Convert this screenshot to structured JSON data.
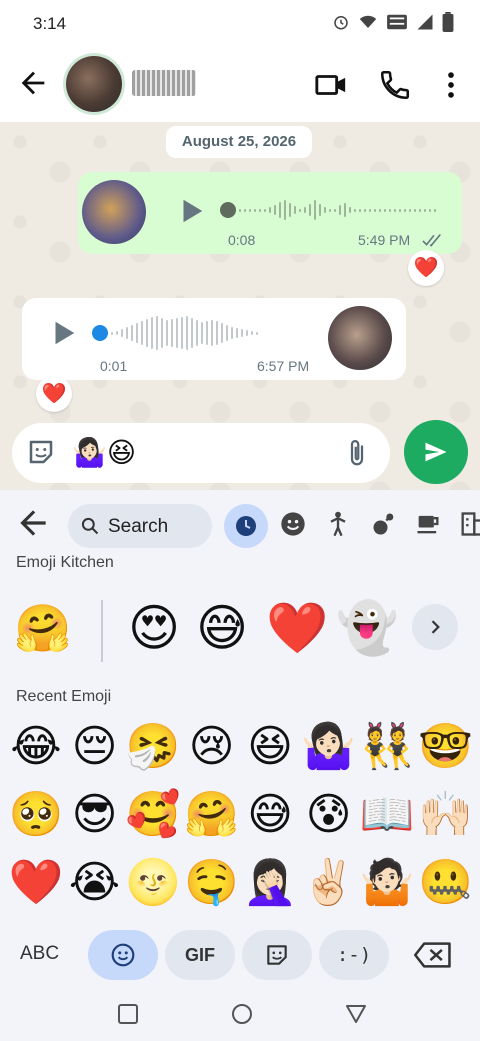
{
  "status": {
    "time": "3:14",
    "icons": [
      "alarm-icon",
      "wifi-icon",
      "vowifi-icon",
      "signal-icon",
      "battery-icon"
    ]
  },
  "header": {
    "back": "back-arrow-icon",
    "video_call": "video-call-icon",
    "voice_call": "phone-icon",
    "menu": "more-vert-icon"
  },
  "chat": {
    "date": "August 25, 2026",
    "messages": [
      {
        "direction": "outgoing",
        "type": "voice",
        "duration": "0:08",
        "time": "5:49 PM",
        "status": "read-ticks",
        "reaction": "❤️"
      },
      {
        "direction": "incoming",
        "type": "voice",
        "duration": "0:01",
        "time": "6:57 PM",
        "reaction": "❤️"
      }
    ]
  },
  "input": {
    "text": "🤷🏻‍♀️😆"
  },
  "keyboard": {
    "search_label": "Search",
    "categories": [
      "recent-clock-icon",
      "smiley-icon",
      "person-icon",
      "activity-icon",
      "food-icon",
      "building-icon"
    ],
    "kitchen_label": "Emoji Kitchen",
    "kitchen_base": "🤗",
    "kitchen_items": [
      "😍",
      "😅",
      "❤️",
      "👻"
    ],
    "recent_label": "Recent Emoji",
    "recent": [
      "😂",
      "😔",
      "🤧",
      "😢",
      "😆",
      "🤷🏻‍♀️",
      "👯",
      "🤓",
      "🥺",
      "😎",
      "🥰",
      "🤗",
      "😅",
      "😰",
      "📖",
      "🙌🏻",
      "❤️",
      "😭",
      "🌝",
      "🤤",
      "🤦🏻‍♀️",
      "✌🏻",
      "🤷🏻",
      "🤐"
    ],
    "bottom": {
      "abc": "ABC",
      "gif": "GIF",
      "emoticon": ":-)"
    }
  }
}
